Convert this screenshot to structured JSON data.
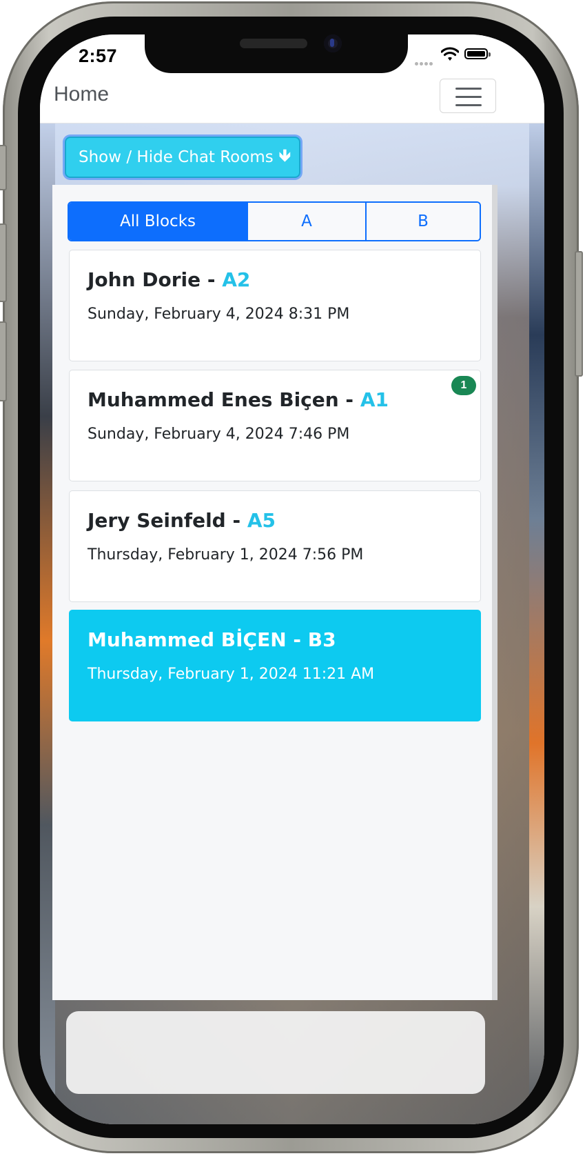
{
  "status_bar": {
    "time": "2:57"
  },
  "navbar": {
    "brand": "Home"
  },
  "toggle_button": {
    "label": "Show / Hide Chat Rooms",
    "arrow": "🡻"
  },
  "tabs": [
    {
      "label": "All Blocks",
      "active": true
    },
    {
      "label": "A",
      "active": false
    },
    {
      "label": "B",
      "active": false
    }
  ],
  "rooms": [
    {
      "name": "John Dorie - ",
      "block": "A2",
      "date": "Sunday, February 4, 2024 8:31 PM",
      "unread": null,
      "active": false
    },
    {
      "name": "Muhammed Enes Biçen - ",
      "block": "A1",
      "date": "Sunday, February 4, 2024 7:46 PM",
      "unread": "1",
      "active": false
    },
    {
      "name": "Jery Seinfeld - ",
      "block": "A5",
      "date": "Thursday, February 1, 2024 7:56 PM",
      "unread": null,
      "active": false
    },
    {
      "name": "Muhammed BİÇEN - ",
      "block": "B3",
      "date": "Thursday, February 1, 2024 11:21 AM",
      "unread": null,
      "active": true
    }
  ],
  "colors": {
    "primary": "#0d6efd",
    "info": "#0dcaf0",
    "badge_success": "#198754"
  }
}
